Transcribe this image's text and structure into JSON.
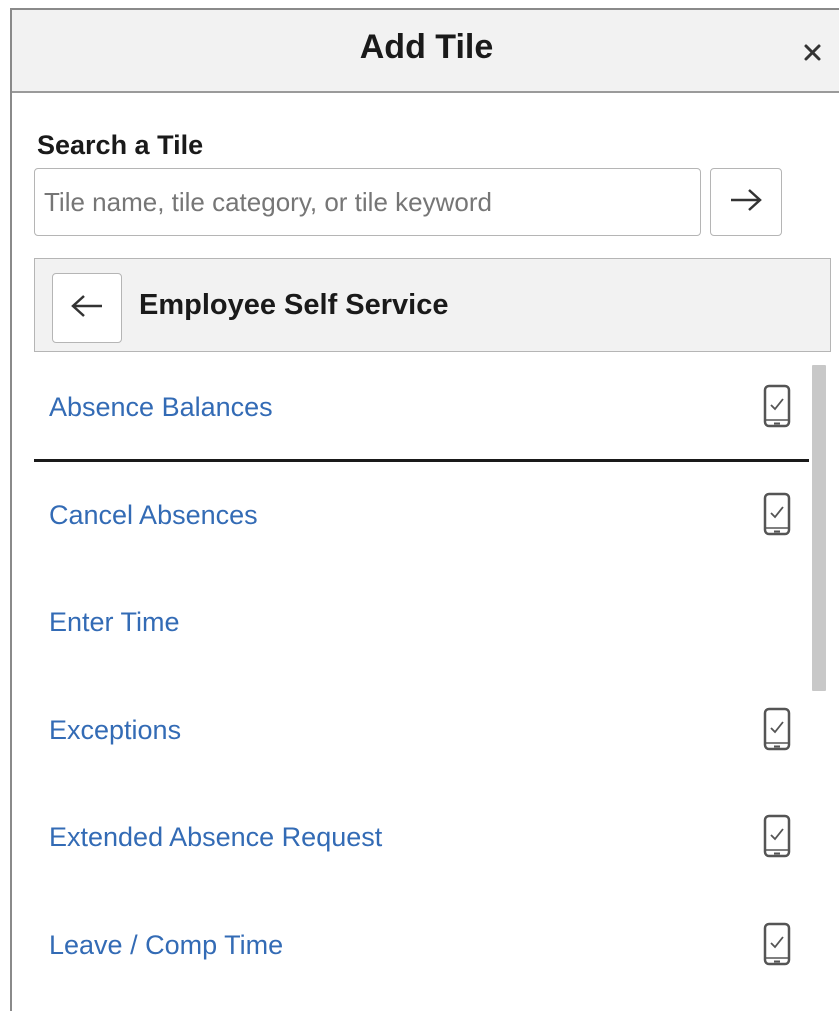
{
  "dialog": {
    "title": "Add Tile",
    "close_icon": "close-icon"
  },
  "search": {
    "label": "Search a Tile",
    "placeholder": "Tile name, tile category, or tile keyword",
    "value": "",
    "go_icon": "arrow-right-icon"
  },
  "category": {
    "back_icon": "arrow-left-icon",
    "title": "Employee Self Service"
  },
  "tiles": [
    {
      "label": "Absence Balances",
      "mobile": true,
      "selected": true
    },
    {
      "label": "Cancel Absences",
      "mobile": true,
      "selected": false
    },
    {
      "label": "Enter Time",
      "mobile": false,
      "selected": false
    },
    {
      "label": "Exceptions",
      "mobile": true,
      "selected": false
    },
    {
      "label": "Extended Absence Request",
      "mobile": true,
      "selected": false
    },
    {
      "label": "Leave / Comp Time",
      "mobile": true,
      "selected": false
    }
  ],
  "colors": {
    "link": "#336bb5",
    "header_bg": "#f2f2f2",
    "border": "#b5b5b5"
  }
}
